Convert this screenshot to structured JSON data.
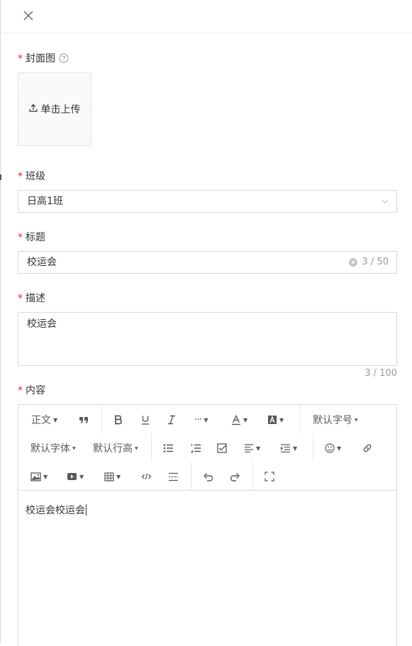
{
  "header": {
    "close_icon": "close-icon"
  },
  "cover": {
    "label": "封面图",
    "required_mark": "*",
    "help_icon": "question-circle-icon",
    "upload_label": "单击上传",
    "upload_icon": "upload-icon"
  },
  "class_field": {
    "label": "班级",
    "required_mark": "*",
    "value": "日高1班",
    "icon": "chevron-down-icon"
  },
  "title_field": {
    "label": "标题",
    "required_mark": "*",
    "value": "校运会",
    "counter": "3 / 50",
    "clear_icon": "clear-circle-icon"
  },
  "desc_field": {
    "label": "描述",
    "required_mark": "*",
    "value": "校运会",
    "counter": "3 / 100"
  },
  "content_field": {
    "label": "内容",
    "required_mark": "*",
    "toolbar": {
      "paragraph": "正文",
      "font_size": "默认字号",
      "font_family": "默认字体",
      "line_height": "默认行高",
      "icons": [
        "quote-icon",
        "bold-icon",
        "underline-icon",
        "italic-icon",
        "more-icon",
        "font-color-icon",
        "bg-color-icon",
        "bulleted-list-icon",
        "numbered-list-icon",
        "todo-icon",
        "align-icon",
        "indent-icon",
        "emoji-icon",
        "link-icon",
        "image-icon",
        "video-icon",
        "table-icon",
        "code-icon",
        "divider-icon",
        "undo-icon",
        "redo-icon",
        "fullscreen-icon"
      ]
    },
    "body": "校运会校运会"
  },
  "colors": {
    "required": "#f5222d",
    "border": "#d9d9d9",
    "text": "#333333",
    "muted": "#999999"
  }
}
